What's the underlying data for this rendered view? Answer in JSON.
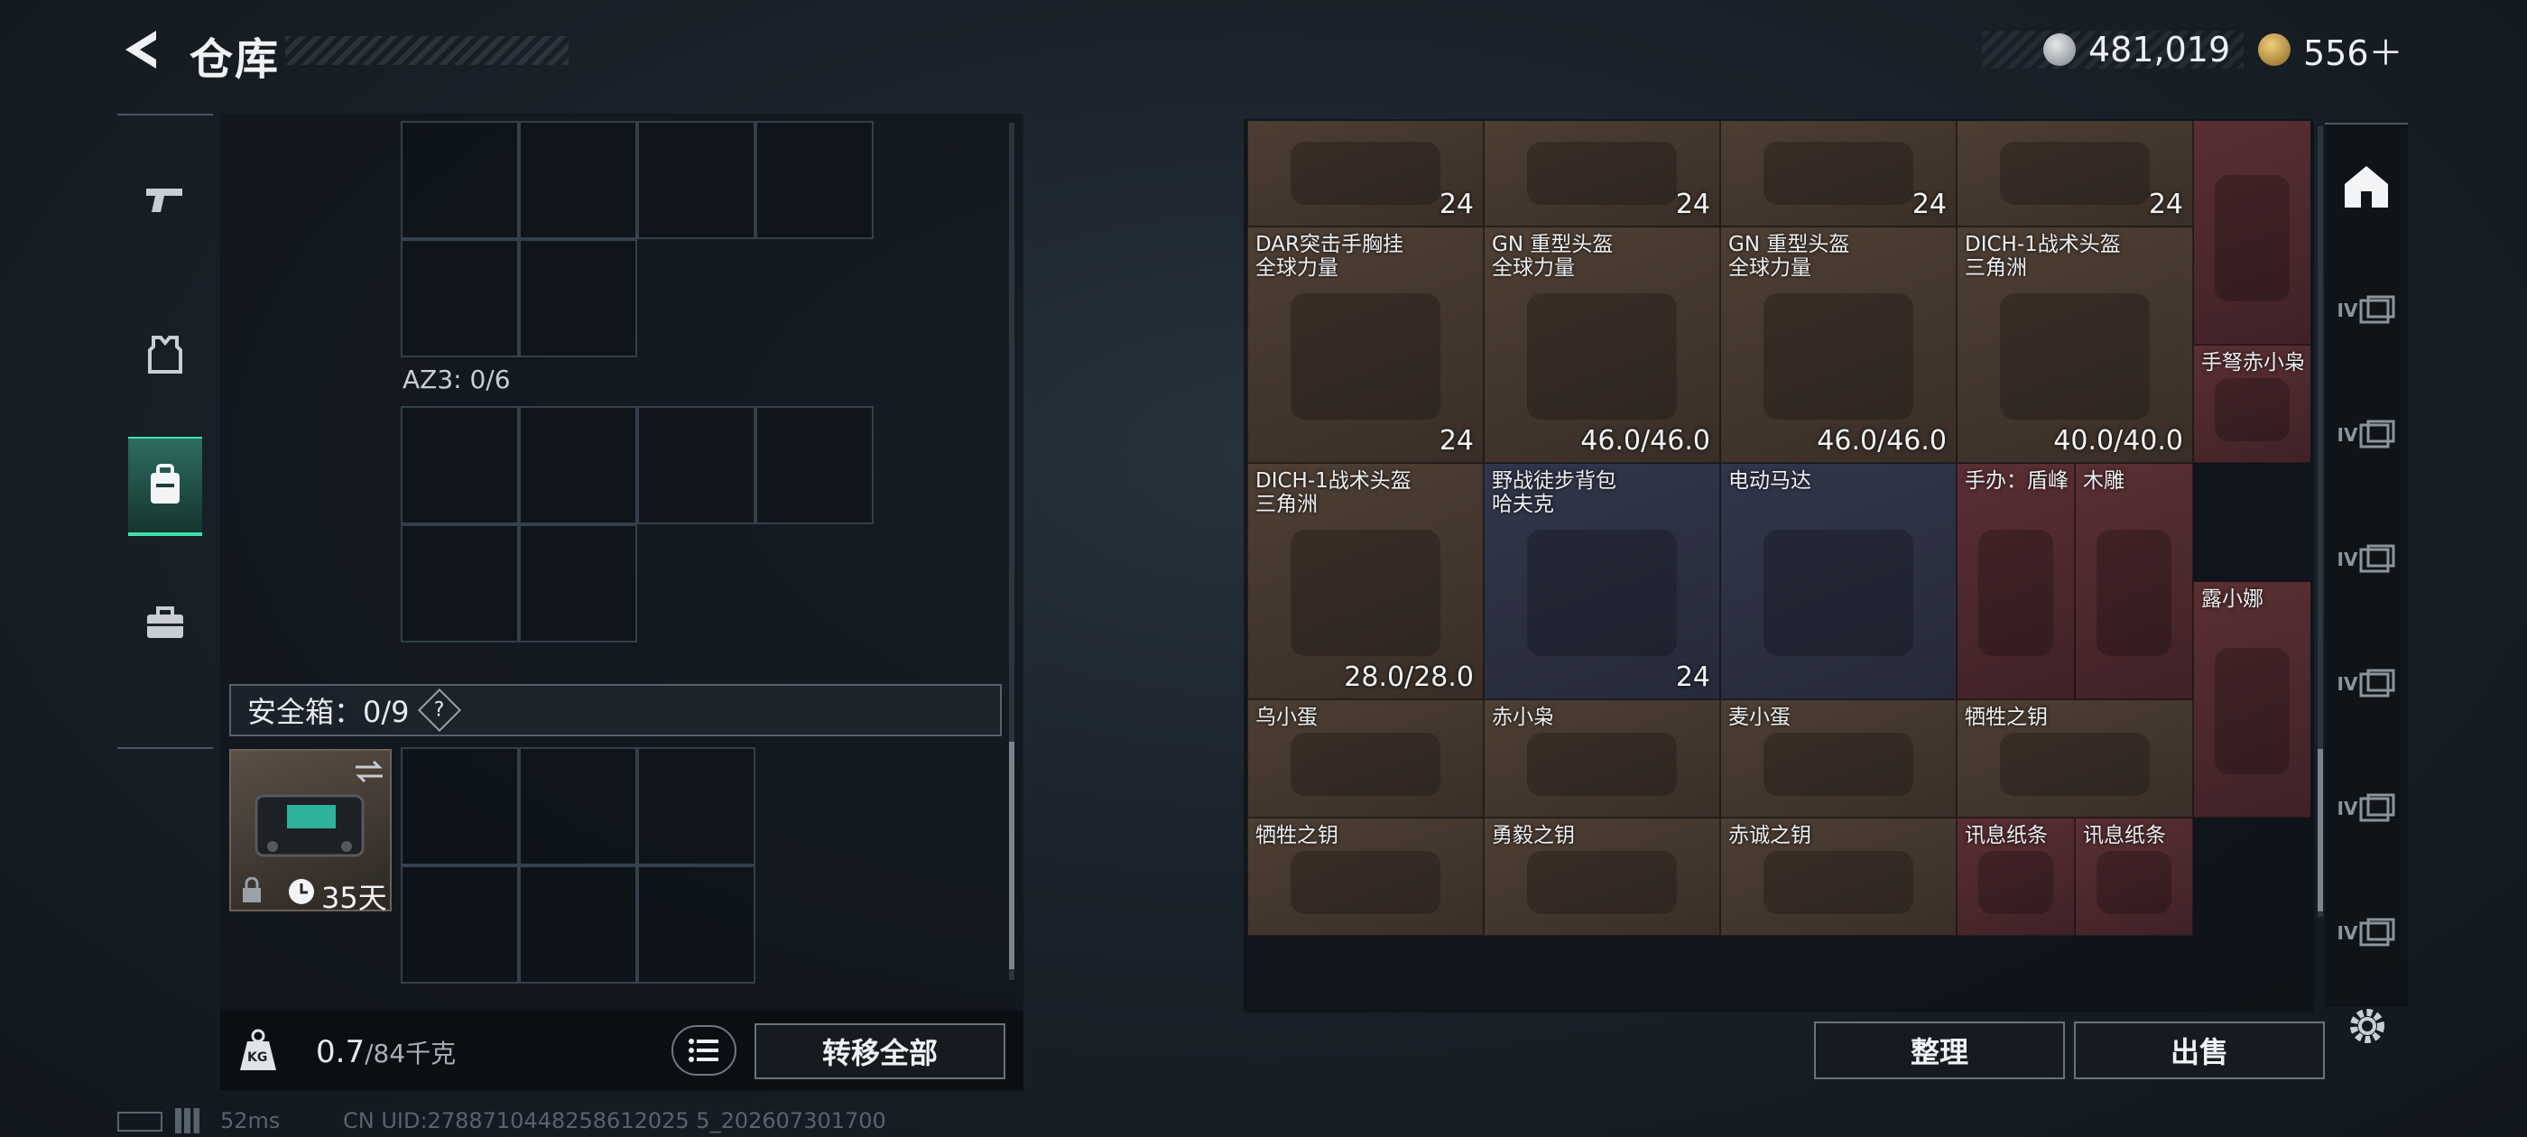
{
  "header": {
    "title": "仓库",
    "back_icon": "back-arrow-icon"
  },
  "currency": {
    "coin_amount": "481,019",
    "premium_amount": "556＋",
    "coin_color": "#b7bcc2",
    "premium_color": "#c99a3c"
  },
  "left_nav": [
    {
      "name": "weapon",
      "icon": "pistol-icon",
      "active": false
    },
    {
      "name": "armor",
      "icon": "armor-vest-icon",
      "active": false
    },
    {
      "name": "backpack",
      "icon": "backpack-icon",
      "active": true
    },
    {
      "name": "case",
      "icon": "briefcase-icon",
      "active": false
    }
  ],
  "loadout": {
    "az3_label": "AZ3: 0/6",
    "safe_label": "安全箱：0/9",
    "help_glyph": "?",
    "safebox_days": "35天"
  },
  "bottom_left": {
    "weight_value": "0.7",
    "weight_cap": "/84千克",
    "weight_icon": "KG",
    "transfer_all": "转移全部"
  },
  "items": [
    {
      "name": "",
      "count": "24",
      "color": "brown"
    },
    {
      "name": "",
      "count": "24",
      "color": "brown"
    },
    {
      "name": "",
      "count": "24",
      "color": "brown"
    },
    {
      "name": "",
      "count": "24",
      "color": "brown"
    },
    {
      "name": "",
      "count": "",
      "color": "red"
    },
    {
      "name": "DAR突击手胸挂\n全球力量",
      "count": "24",
      "color": "brown"
    },
    {
      "name": "GN 重型头盔\n全球力量",
      "count": "46.0/46.0",
      "color": "brown"
    },
    {
      "name": "GN 重型头盔\n全球力量",
      "count": "46.0/46.0",
      "color": "brown"
    },
    {
      "name": "DICH-1战术头盔\n三角洲",
      "count": "40.0/40.0",
      "color": "brown"
    },
    {
      "name": "手弩赤小枭",
      "count": "",
      "color": "red"
    },
    {
      "name": "DICH-1战术头盔\n三角洲",
      "count": "28.0/28.0",
      "color": "brown"
    },
    {
      "name": "野战徒步背包\n哈夫克",
      "count": "24",
      "color": "blue"
    },
    {
      "name": "电动马达",
      "count": "",
      "color": "blue"
    },
    {
      "name": "手办：盾峰",
      "count": "",
      "color": "red"
    },
    {
      "name": "木雕",
      "count": "",
      "color": "red"
    },
    {
      "name": "露小娜",
      "count": "",
      "color": "red"
    },
    {
      "name": "乌小蛋",
      "count": "",
      "color": "brown"
    },
    {
      "name": "赤小枭",
      "count": "",
      "color": "brown"
    },
    {
      "name": "麦小蛋",
      "count": "",
      "color": "brown"
    },
    {
      "name": "牺牲之钥",
      "count": "",
      "color": "brown"
    },
    {
      "name": "牺牲之钥",
      "count": "",
      "color": "brown"
    },
    {
      "name": "勇毅之钥",
      "count": "",
      "color": "brown"
    },
    {
      "name": "赤诚之钥",
      "count": "",
      "color": "brown"
    },
    {
      "name": "讯息纸条",
      "count": "",
      "color": "red"
    },
    {
      "name": "讯息纸条",
      "count": "",
      "color": "red"
    }
  ],
  "bottom_right": {
    "sort": "整理",
    "sell": "出售"
  },
  "right_nav": [
    {
      "icon": "warehouse-icon",
      "label": ""
    },
    {
      "icon": "storage-tab-1-icon",
      "label": "IV"
    },
    {
      "icon": "storage-tab-2-icon",
      "label": "IV"
    },
    {
      "icon": "storage-tab-3-icon",
      "label": "IV"
    },
    {
      "icon": "storage-tab-4-icon",
      "label": "IV"
    },
    {
      "icon": "storage-tab-5-icon",
      "label": "IV"
    },
    {
      "icon": "storage-tab-6-icon",
      "label": "IV"
    }
  ],
  "footer": {
    "ping": "52ms",
    "uid": "CN UID:2788710448258612025 5_202607301700"
  }
}
